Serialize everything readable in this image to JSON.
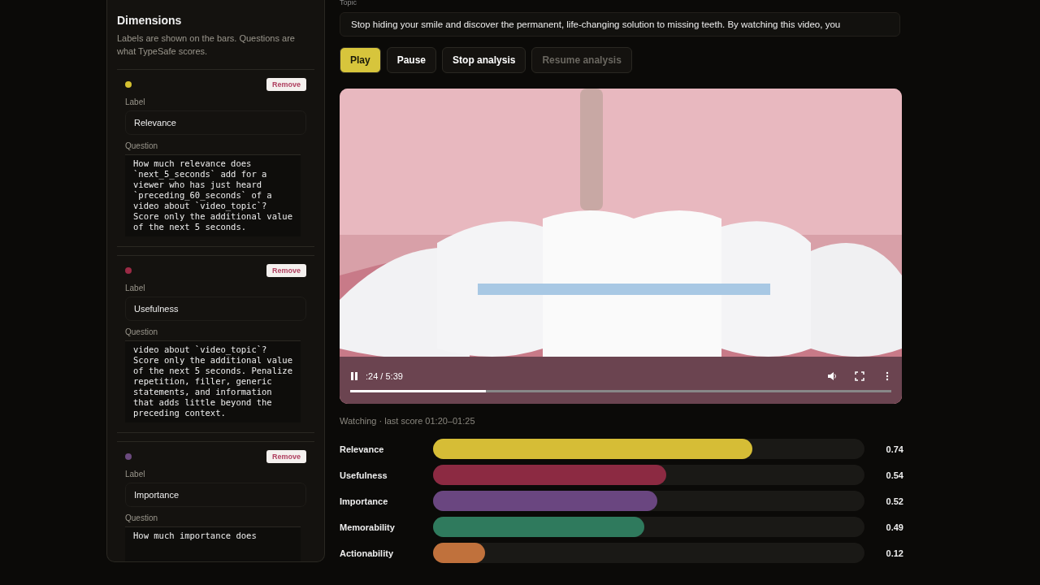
{
  "dimensions_panel": {
    "title": "Dimensions",
    "description": "Labels are shown on the bars. Questions are what TypeSafe scores.",
    "items": [
      {
        "color": "#d4c030",
        "remove": "Remove",
        "label_caption": "Label",
        "label": "Relevance",
        "question_caption": "Question",
        "question": "How much relevance does `next_5_seconds` add for a viewer who has just heard `preceding_60_seconds` of a video about `video_topic`? Score only the additional value of the next 5 seconds."
      },
      {
        "color": "#9b2a45",
        "remove": "Remove",
        "label_caption": "Label",
        "label": "Usefulness",
        "question_caption": "Question",
        "question": "video about `video_topic`? Score only the additional value of the next 5 seconds. Penalize repetition, filler, generic statements, and information that adds little beyond the preceding context."
      },
      {
        "color": "#6b4a7e",
        "remove": "Remove",
        "label_caption": "Label",
        "label": "Importance",
        "question_caption": "Question",
        "question": "How much importance does"
      }
    ]
  },
  "topic": {
    "caption": "Topic",
    "value": "Stop hiding your smile and discover the permanent, life-changing solution to missing teeth. By watching this video, you"
  },
  "buttons": [
    {
      "label": "Play",
      "kind": "primary"
    },
    {
      "label": "Pause",
      "kind": "normal"
    },
    {
      "label": "Stop analysis",
      "kind": "normal"
    },
    {
      "label": "Resume analysis",
      "kind": "disabled"
    }
  ],
  "video": {
    "kind": "picture",
    "time": ":24 / 5:39",
    "level": 0.25
  },
  "status": "Watching · last score 01:20–01:25",
  "scores": [
    {
      "label": "Relevance",
      "value": "0.74",
      "level": 0.74,
      "color": "#d6bd36"
    },
    {
      "label": "Usefulness",
      "value": "0.54",
      "level": 0.54,
      "color": "#8c2a42"
    },
    {
      "label": "Importance",
      "value": "0.52",
      "level": 0.52,
      "color": "#6a4680"
    },
    {
      "label": "Memorability",
      "value": "0.49",
      "level": 0.49,
      "color": "#2f7a5d"
    },
    {
      "label": "Actionability",
      "value": "0.12",
      "level": 0.12,
      "color": "#c0713c"
    }
  ]
}
